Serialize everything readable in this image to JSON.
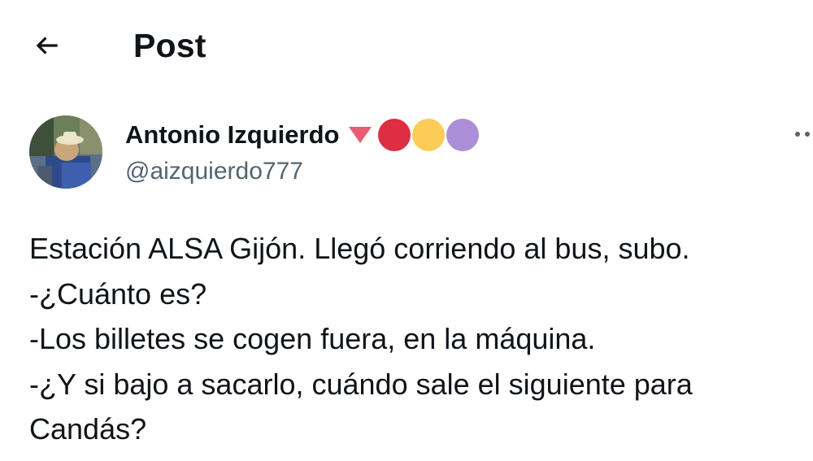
{
  "header": {
    "back_icon": "arrow-left-icon",
    "title": "Post"
  },
  "author": {
    "name": "Antonio Izquierdo",
    "handle": "@aizquierdo777",
    "avatar_icon": "avatar-photo",
    "name_emojis": [
      {
        "icon": "red-triangle-down-icon",
        "color": "#e85d71"
      },
      {
        "icon": "red-circle-icon",
        "color": "#dd2e44"
      },
      {
        "icon": "yellow-circle-icon",
        "color": "#fdcb58"
      },
      {
        "icon": "purple-circle-icon",
        "color": "#aa8ed6"
      }
    ],
    "more_icon": "more-options-icon"
  },
  "post": {
    "lines": [
      "Estación ALSA Gijón. Llegó corriendo al bus, subo.",
      "-¿Cuánto es?",
      "-Los billetes se cogen fuera, en la máquina.",
      "-¿Y si bajo a sacarlo, cuándo sale el siguiente para",
      "Candás?"
    ]
  },
  "colors": {
    "text": "#0f1419",
    "secondary_text": "#536471",
    "background": "#ffffff"
  }
}
